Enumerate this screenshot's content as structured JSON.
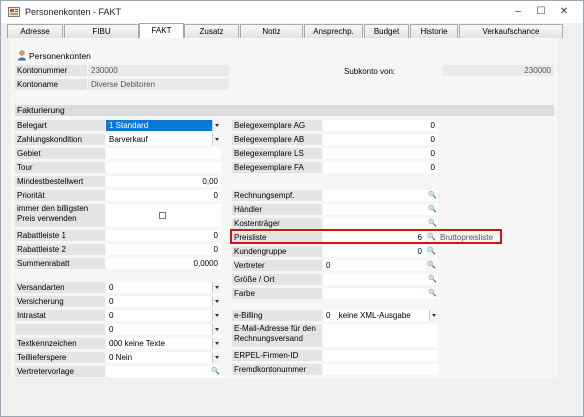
{
  "window": {
    "title": "Personenkonten - FAKT"
  },
  "tabs": [
    "Adresse",
    "FIBU",
    "FAKT",
    "Zusatz",
    "Notiz",
    "Ansprechp.",
    "Budget",
    "Historie",
    "Verkaufschance"
  ],
  "header": {
    "section": "Personenkonten",
    "kontonummer_label": "Kontonummer",
    "kontonummer": "230000",
    "kontoname_label": "Kontoname",
    "kontoname": "Diverse Debitoren",
    "subkonto_label": "Subkonto von:",
    "subkonto": "230000"
  },
  "fakturierung": {
    "title": "Fakturierung",
    "belegart_label": "Belegart",
    "belegart": "1 Standard",
    "zahlungskondition_label": "Zahlungskondition",
    "zahlungskondition": "Barverkauf",
    "gebiet_label": "Gebiet",
    "tour_label": "Tour",
    "mindestbestellwert_label": "Mindestbestellwert",
    "mindestbestellwert": "0,00",
    "prioritaet_label": "Priorität",
    "prioritaet": "0",
    "billigsten_label_1": "immer den billigsten",
    "billigsten_label_2": "Preis verwenden",
    "rabattleiste1_label": "Rabattleiste 1",
    "rabattleiste1": "0",
    "rabattleiste2_label": "Rabattleiste 2",
    "rabattleiste2": "0",
    "summenrabatt_label": "Summenrabatt",
    "summenrabatt": "0,0000",
    "belegexemplare_ag_label": "Belegexemplare AG",
    "belegexemplare_ag": "0",
    "belegexemplare_ab_label": "Belegexemplare AB",
    "belegexemplare_ab": "0",
    "belegexemplare_ls_label": "Belegexemplare LS",
    "belegexemplare_ls": "0",
    "belegexemplare_fa_label": "Belegexemplare FA",
    "belegexemplare_fa": "0",
    "rechnungsempf_label": "Rechnungsempf.",
    "haendler_label": "Händler",
    "kostentraeger_label": "Kostenträger",
    "preisliste_label": "Preisliste",
    "preisliste": "6",
    "preisliste_name": "Bruttopreisliste",
    "kundengruppe_label": "Kundengruppe",
    "kundengruppe": "0",
    "vertreter_label": "Vertreter",
    "vertreter": "0",
    "groesse_label": "Größe / Ort",
    "farbe_label": "Farbe"
  },
  "lower": {
    "versandarten_label": "Versandarten",
    "versandarten": "0",
    "versicherung_label": "Versicherung",
    "versicherung": "0",
    "intrastat_label": "Intrastat",
    "intrastat": "0",
    "blank_value": "0",
    "textkennzeichen_label": "Textkennzeichen",
    "textkennzeichen": "000 keine Texte",
    "teillieferung_label": "Teillieferspere",
    "teillieferung": "0 Nein",
    "vertretervorlage_label": "Vertretervorlage",
    "ebilling_label": "e-Billing",
    "ebilling": "0",
    "ebilling_text": "keine XML-Ausgabe",
    "email_label_1": "E-Mail-Adresse für den",
    "email_label_2": "Rechnungsversand",
    "erpel_label": "ERPEL-Firmen-ID",
    "fremdkonto_label": "Fremdkontonummer"
  },
  "colors": {
    "highlight": "#d11414",
    "selection": "#0a78d7"
  }
}
